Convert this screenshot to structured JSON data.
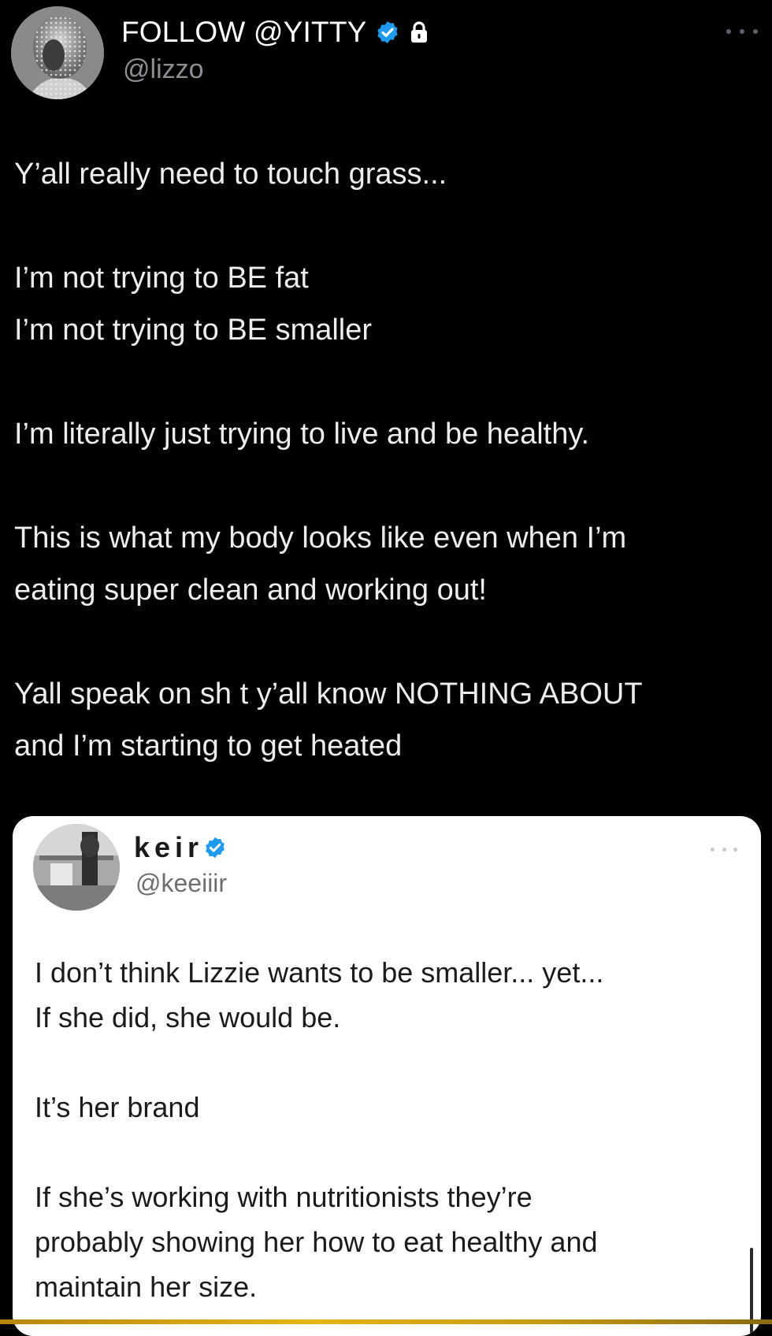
{
  "tweet": {
    "display_name": "FOLLOW @YITTY",
    "handle": "@lizzo",
    "lines": [
      "Y’all really need to touch grass...",
      "",
      "I’m not trying to BE fat",
      "I’m not trying to BE smaller",
      "",
      "I’m literally just trying to live and be healthy.",
      "",
      "This is what my body looks like even when I’m",
      "eating super clean and working out!",
      "",
      "Yall speak on sh t y’all know NOTHING ABOUT",
      "and I’m starting to get heated"
    ],
    "icons": {
      "verified": "verified-badge-icon",
      "lock": "lock-icon",
      "more": "more-options-icon"
    },
    "colors": {
      "background": "#000000",
      "verified": "#1d9bf0",
      "handle": "#8b8f94"
    }
  },
  "quoted_tweet": {
    "display_name": "keir",
    "handle": "@keeiiir",
    "lines": [
      "I don’t think Lizzie wants to be smaller...  yet...",
      "If she did, she would be.",
      "",
      "It’s her brand",
      "",
      "If she’s working with nutritionists they’re",
      "probably showing her how to eat healthy and",
      "maintain her size."
    ],
    "icons": {
      "verified": "verified-badge-icon",
      "more": "more-options-icon"
    },
    "colors": {
      "background": "#ffffff",
      "verified": "#1d9bf0"
    }
  }
}
